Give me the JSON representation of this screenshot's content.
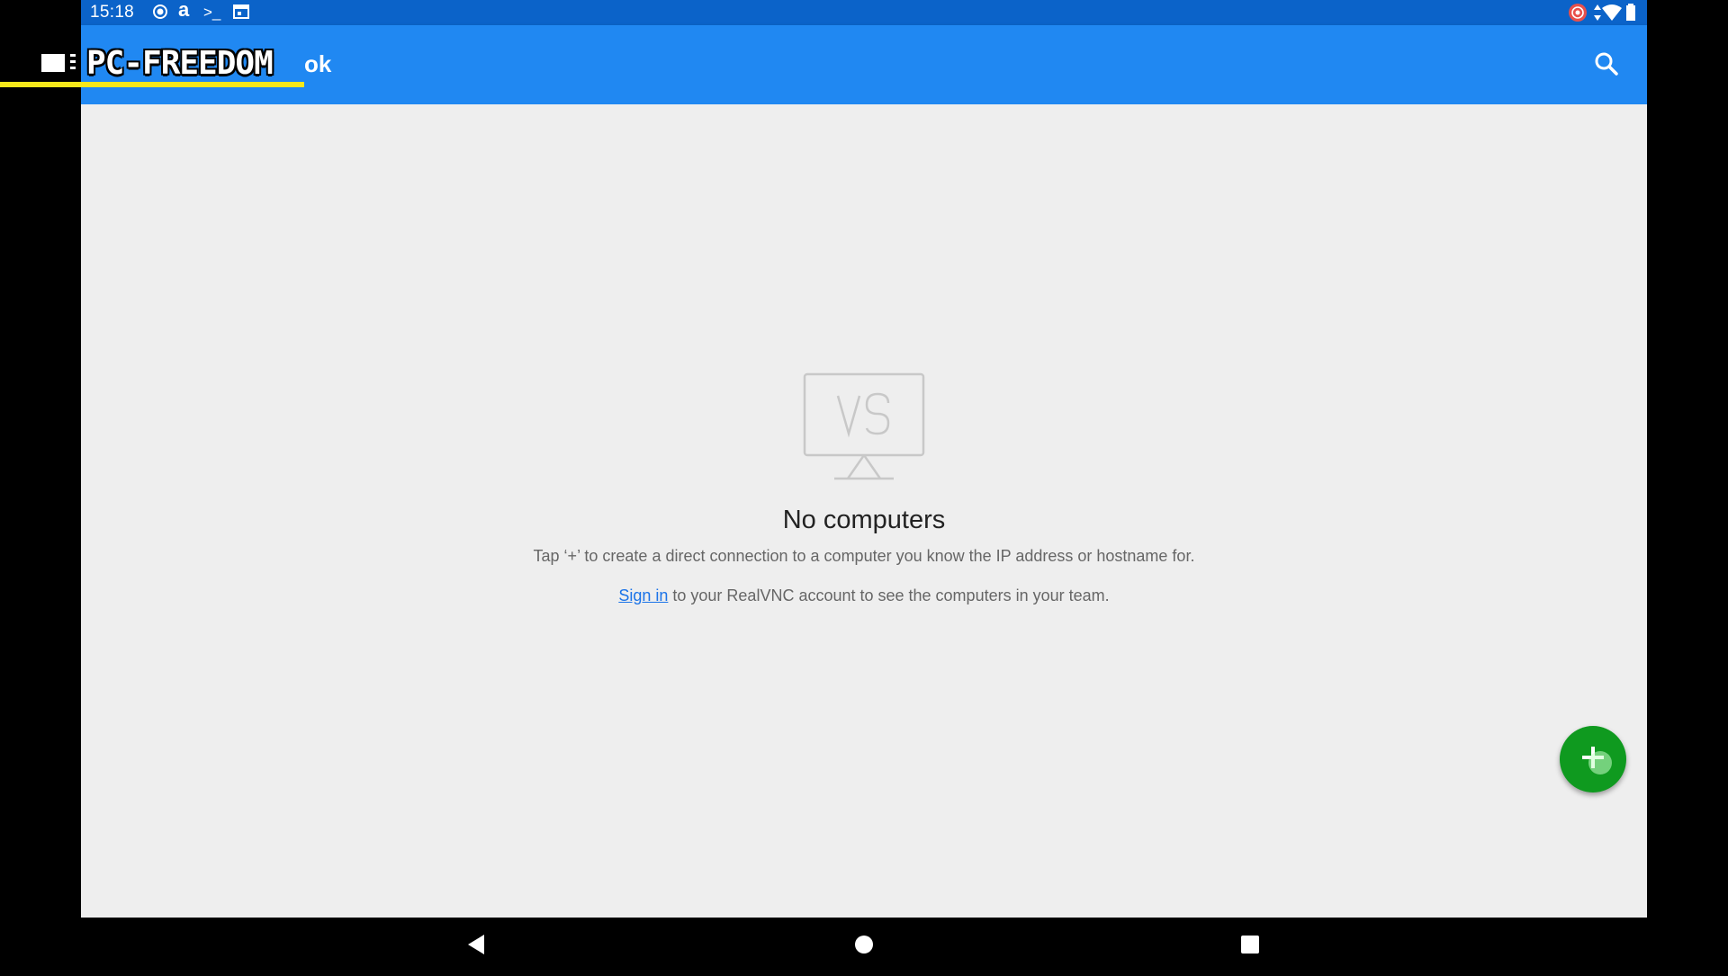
{
  "status_bar": {
    "time": "15:18",
    "icons_left": [
      "record-icon",
      "amazon-icon",
      "terminal-icon",
      "calendar-icon"
    ],
    "icons_right": [
      "screen-record-icon",
      "data-arrows-icon",
      "wifi-icon",
      "battery-icon"
    ]
  },
  "app_bar": {
    "title": "ok",
    "search_icon": "search-icon",
    "background": "#2088f2"
  },
  "watermark": {
    "text": "PC-FREEDOM"
  },
  "empty_state": {
    "title": "No computers",
    "description": "Tap ‘+’ to create a direct connection to a computer you know the IP address or hostname for.",
    "signin_link": "Sign in",
    "signin_rest": " to your RealVNC account to see the computers in your team."
  },
  "fab": {
    "icon": "plus-icon",
    "color": "#0f9a1f"
  },
  "nav_bar": {
    "buttons": [
      "back-icon",
      "home-icon",
      "recents-icon"
    ]
  }
}
